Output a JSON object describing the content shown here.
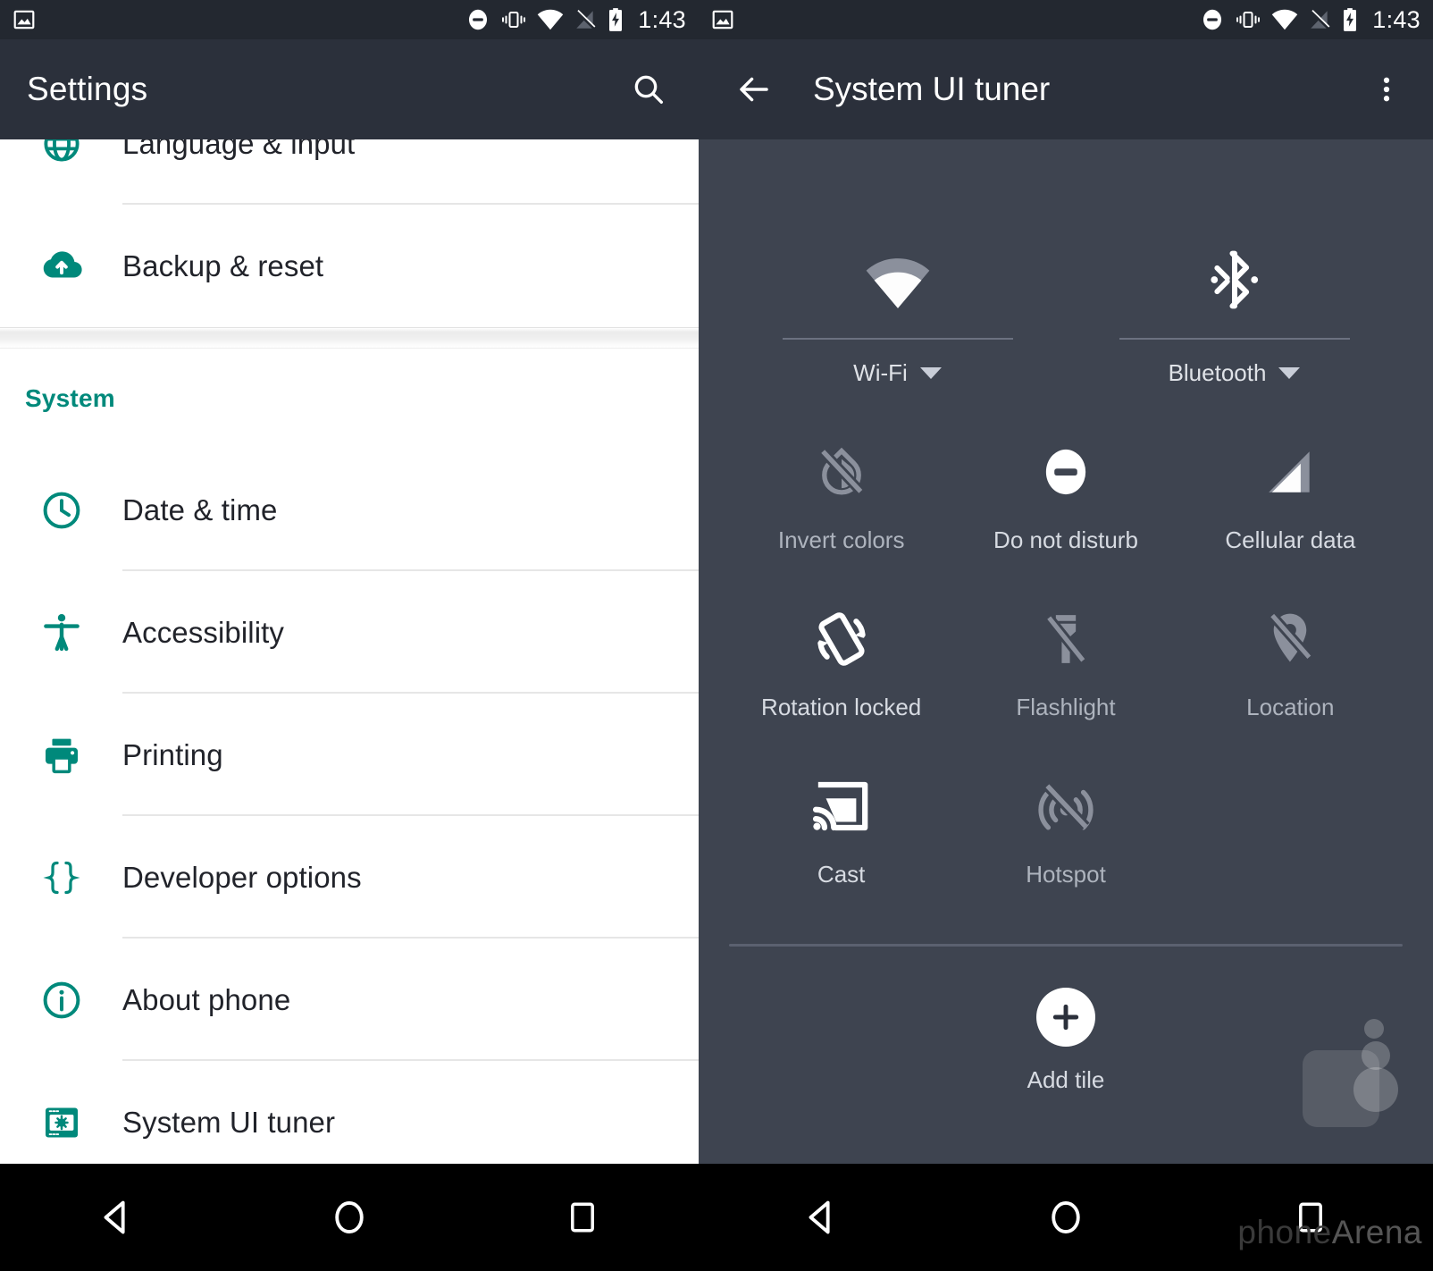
{
  "status_bar": {
    "time": "1:43",
    "icons": [
      "photo-icon",
      "do-not-disturb-icon",
      "vibrate-icon",
      "wifi-icon",
      "cellular-off-icon",
      "battery-charging-icon"
    ]
  },
  "left_screen": {
    "appbar": {
      "title": "Settings",
      "search_icon": "search-icon"
    },
    "items_top": [
      {
        "label": "Language & input",
        "icon": "language-globe-icon"
      },
      {
        "label": "Backup & reset",
        "icon": "cloud-upload-icon"
      }
    ],
    "section": {
      "title": "System"
    },
    "items_system": [
      {
        "label": "Date & time",
        "icon": "clock-icon"
      },
      {
        "label": "Accessibility",
        "icon": "accessibility-icon"
      },
      {
        "label": "Printing",
        "icon": "printer-icon"
      },
      {
        "label": "Developer options",
        "icon": "braces-icon"
      },
      {
        "label": "About phone",
        "icon": "info-icon"
      },
      {
        "label": "System UI tuner",
        "icon": "system-ui-tuner-icon"
      }
    ]
  },
  "right_screen": {
    "appbar": {
      "back_icon": "arrow-back-icon",
      "title": "System UI tuner",
      "overflow_icon": "overflow-menu-icon"
    },
    "dual_tiles": [
      {
        "label": "Wi-Fi",
        "icon": "wifi-icon",
        "state": "on",
        "expandable": true
      },
      {
        "label": "Bluetooth",
        "icon": "bluetooth-icon",
        "state": "on",
        "expandable": true
      }
    ],
    "tiles": [
      {
        "label": "Invert colors",
        "icon": "invert-colors-off-icon",
        "state": "off"
      },
      {
        "label": "Do not disturb",
        "icon": "do-not-disturb-icon",
        "state": "on"
      },
      {
        "label": "Cellular data",
        "icon": "cellular-data-icon",
        "state": "on"
      },
      {
        "label": "Rotation locked",
        "icon": "rotation-locked-icon",
        "state": "on"
      },
      {
        "label": "Flashlight",
        "icon": "flashlight-off-icon",
        "state": "off"
      },
      {
        "label": "Location",
        "icon": "location-off-icon",
        "state": "off"
      },
      {
        "label": "Cast",
        "icon": "cast-icon",
        "state": "on"
      },
      {
        "label": "Hotspot",
        "icon": "hotspot-off-icon",
        "state": "off"
      }
    ],
    "add_tile": {
      "label": "Add tile",
      "icon": "plus-icon"
    }
  },
  "nav_bar": {
    "back": "back-triangle-icon",
    "home": "home-circle-icon",
    "recents": "recents-square-icon"
  },
  "watermark": {
    "prefix": "phone",
    "suffix": "Arena"
  },
  "colors": {
    "status_bar": "#232830",
    "app_bar": "#2b303b",
    "tuner_background": "#3e4450",
    "accent_teal": "#00897b",
    "list_background": "#ffffff",
    "nav_bar": "#000000"
  }
}
